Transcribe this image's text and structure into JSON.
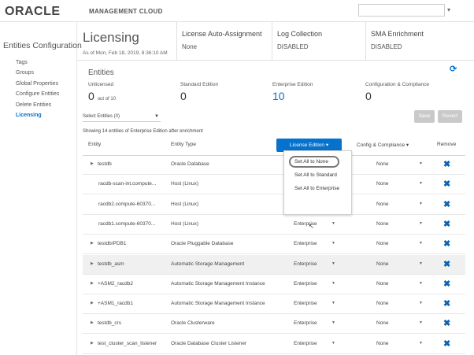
{
  "header": {
    "brand": "ORACLE",
    "product": "MANAGEMENT CLOUD"
  },
  "sidebar": {
    "title": "Entities Configuration",
    "items": [
      {
        "label": "Tags",
        "active": false
      },
      {
        "label": "Groups",
        "active": false
      },
      {
        "label": "Global Properties",
        "active": false
      },
      {
        "label": "Configure Entities",
        "active": false
      },
      {
        "label": "Delete Entities",
        "active": false
      },
      {
        "label": "Licensing",
        "active": true
      }
    ]
  },
  "page": {
    "title": "Licensing",
    "as_of": "As of Mon, Feb 18, 2019, 8:36:10 AM",
    "auto_assign": {
      "label": "License Auto-Assignment",
      "value": "None"
    },
    "log_collection": {
      "label": "Log Collection",
      "value": "DISABLED"
    },
    "sma": {
      "label": "SMA Enrichment",
      "value": "DISABLED"
    }
  },
  "entities": {
    "title": "Entities",
    "unlicensed": {
      "label": "Unlicensed",
      "value": "0",
      "suffix": "out of 10"
    },
    "standard": {
      "label": "Standard Edition",
      "value": "0"
    },
    "enterprise": {
      "label": "Enterprise Edition",
      "value": "10"
    },
    "config": {
      "label": "Configuration & Compliance",
      "value": "0"
    }
  },
  "toolbar": {
    "select_label": "Select Entities (0)",
    "save_label": "Save",
    "revert_label": "Revert"
  },
  "showing_text": "Showing 14 entities of Enterprise Edition after enrichment",
  "table": {
    "headers": {
      "entity": "Entity",
      "type": "Entity Type",
      "license_btn": "License Edition",
      "config": "Config & Compliance",
      "remove": "Remove"
    },
    "rows": [
      {
        "entity": "testdb",
        "type": "Oracle Database",
        "license": "",
        "config": "None",
        "expandable": true
      },
      {
        "entity": "racdb-scan-int.compute...",
        "type": "Host (Linux)",
        "license": "",
        "config": "None",
        "expandable": false
      },
      {
        "entity": "racdb2.compute-60370...",
        "type": "Host (Linux)",
        "license": "Enterprise",
        "config": "None",
        "expandable": false
      },
      {
        "entity": "racdb1.compute-60370...",
        "type": "Host (Linux)",
        "license": "Enterprise",
        "config": "None",
        "expandable": false
      },
      {
        "entity": "testdb/PDB1",
        "type": "Oracle Pluggable Database",
        "license": "Enterprise",
        "config": "None",
        "expandable": true
      },
      {
        "entity": "testdb_asm",
        "type": "Automatic Storage Management",
        "license": "Enterprise",
        "config": "None",
        "expandable": true
      },
      {
        "entity": "+ASM2_racdb2",
        "type": "Automatic Storage Management Instance",
        "license": "Enterprise",
        "config": "None",
        "expandable": true
      },
      {
        "entity": "+ASM1_racdb1",
        "type": "Automatic Storage Management Instance",
        "license": "Enterprise",
        "config": "None",
        "expandable": true
      },
      {
        "entity": "testdb_crs",
        "type": "Oracle Clusterware",
        "license": "Enterprise",
        "config": "None",
        "expandable": true
      },
      {
        "entity": "test_cluster_scan_listener",
        "type": "Oracle Database Cluster Listener",
        "license": "Enterprise",
        "config": "None",
        "expandable": true
      }
    ]
  },
  "menu": {
    "items": [
      "Set All to None",
      "Set All to Standard",
      "Set All to Enterprise"
    ]
  },
  "colors": {
    "accent": "#0572ce",
    "remove": "#0c61b0"
  }
}
